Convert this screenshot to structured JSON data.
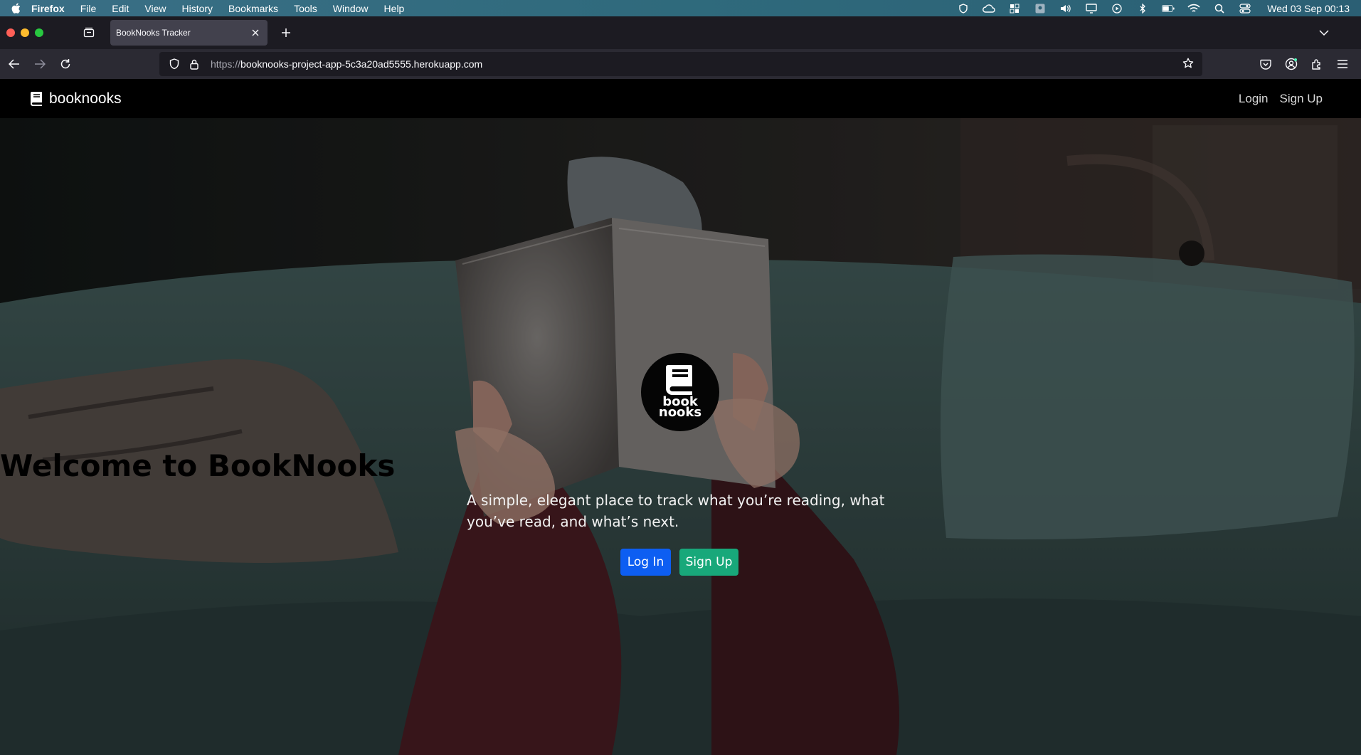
{
  "menubar": {
    "app_name": "Firefox",
    "items": [
      "File",
      "Edit",
      "View",
      "History",
      "Bookmarks",
      "Tools",
      "Window",
      "Help"
    ],
    "clock": "Wed 03 Sep  00:13"
  },
  "browser": {
    "tab_title": "BookNooks Tracker",
    "url_protocol": "https://",
    "url_host": "booknooks-project-app-5c3a20ad5555.herokuapp.com"
  },
  "site": {
    "brand": "booknooks",
    "nav_login": "Login",
    "nav_signup": "Sign Up"
  },
  "hero": {
    "logo_line1": "book",
    "logo_line2": "nooks",
    "title": "Welcome to BookNooks",
    "subtitle": "A simple, elegant place to track what you’re reading, what you’ve read, and what’s next.",
    "login_button": "Log In",
    "signup_button": "Sign Up"
  },
  "colors": {
    "login_button": "#0d5ef2",
    "signup_button": "#18a87a",
    "site_header": "#000000"
  }
}
